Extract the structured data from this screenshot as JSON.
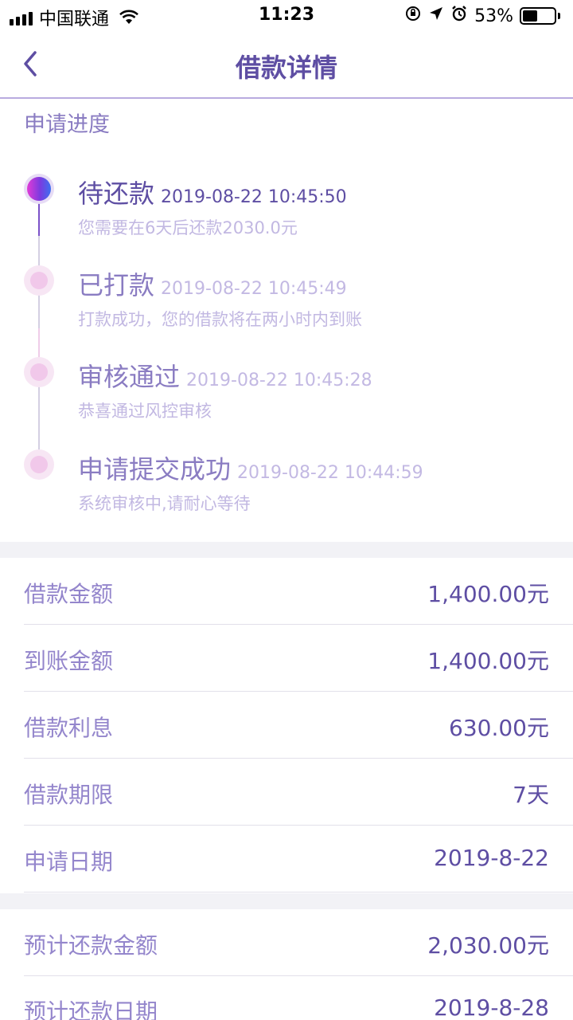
{
  "status_bar": {
    "carrier": "中国联通",
    "time": "11:23",
    "battery": "53%",
    "battery_level": 0.53
  },
  "nav": {
    "title": "借款详情"
  },
  "progress": {
    "label": "申请进度",
    "steps": [
      {
        "title": "待还款",
        "time": "2019-08-22 10:45:50",
        "desc": "您需要在6天后还款2030.0元",
        "active": true
      },
      {
        "title": "已打款",
        "time": "2019-08-22 10:45:49",
        "desc": "打款成功，您的借款将在两小时内到账",
        "active": false
      },
      {
        "title": "审核通过",
        "time": "2019-08-22 10:45:28",
        "desc": "恭喜通过风控审核",
        "active": false
      },
      {
        "title": "申请提交成功",
        "time": "2019-08-22 10:44:59",
        "desc": "系统审核中,请耐心等待",
        "active": false
      }
    ]
  },
  "loan_info": [
    {
      "label": "借款金额",
      "value": "1,400.00元"
    },
    {
      "label": "到账金额",
      "value": "1,400.00元"
    },
    {
      "label": "借款利息",
      "value": "630.00元"
    },
    {
      "label": "借款期限",
      "value": "7天"
    },
    {
      "label": "申请日期",
      "value": "2019-8-22"
    }
  ],
  "repay_info": [
    {
      "label": "预计还款金额",
      "value": "2,030.00元"
    },
    {
      "label": "预计还款日期",
      "value": "2019-8-28"
    }
  ],
  "colors": {
    "accent": "#5e4ea3",
    "muted": "#9486cc",
    "light": "#c2b8e2",
    "divider": "#b9abe0"
  }
}
